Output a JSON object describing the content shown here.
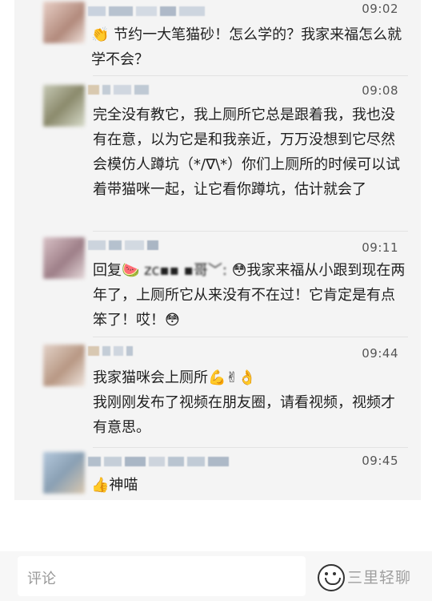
{
  "comments": [
    {
      "avatar_color": "#c8a89c",
      "time": "09:02",
      "text": "👏 节约一大笔猫砂！怎么学的？我家来福怎么就学不会？"
    },
    {
      "avatar_color": "#9a9a82",
      "time": "09:08",
      "text": "完全没有教它，我上厕所它总是跟着我，我也没有在意，以为它是和我亲近，万万没想到它尽然会模仿人蹲坑（*/∇\\*）你们上厕所的时候可以试着带猫咪一起，让它看你蹲坑，估计就会了"
    },
    {
      "avatar_color": "#b79aa0",
      "time": "09:11",
      "reply_prefix": "回复🍉",
      "reply_target": "zc▪▪ ▪哥﹀:",
      "text": "😳我家来福从小跟到现在两年了，上厕所它从来没有不在过！它肯定是有点笨了！哎！😳"
    },
    {
      "avatar_color": "#c9b0a0",
      "time": "09:44",
      "text": "我家猫咪会上厕所💪✌👌",
      "text2": "我刚刚发布了视频在朋友圈，请看视频，视频才有意思。"
    },
    {
      "avatar_color": "#a9b4c4",
      "time": "09:45",
      "text": "👍神喵"
    }
  ],
  "input": {
    "placeholder": "评论"
  },
  "watermark": "三里轻聊"
}
